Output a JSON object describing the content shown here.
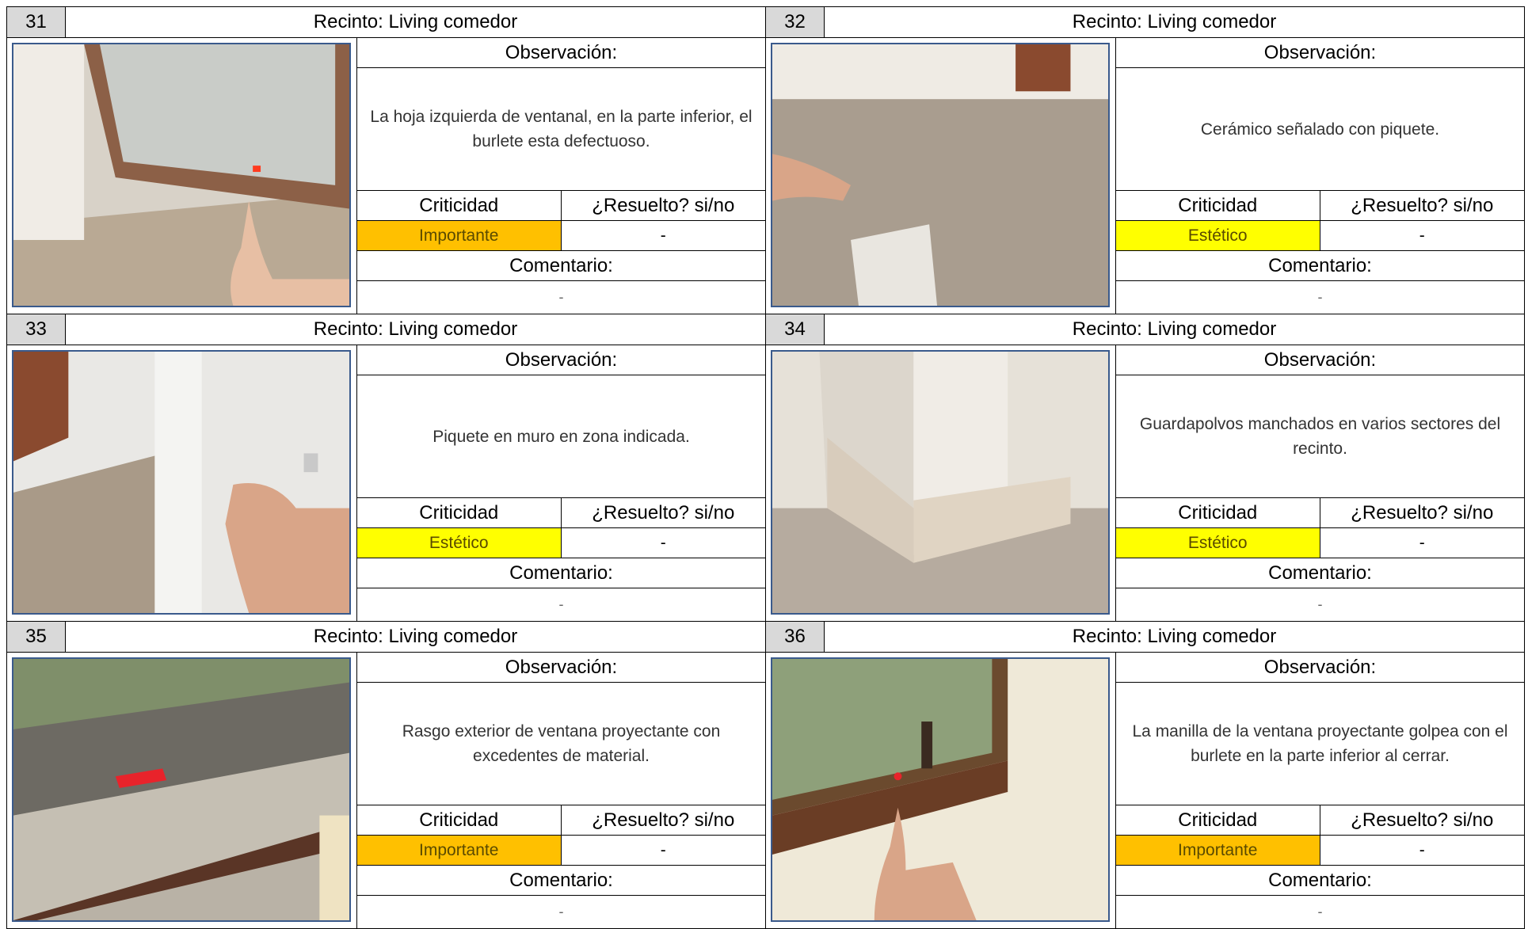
{
  "colors": {
    "importante": "#ffc000",
    "estetico": "#ffff00",
    "header_number_bg": "#d9d9d9",
    "photo_border": "#3a5a8c"
  },
  "labels": {
    "observacion": "Observación:",
    "criticidad": "Criticidad",
    "resuelto": "¿Resuelto? si/no",
    "comentario": "Comentario:"
  },
  "items": [
    {
      "number": "31",
      "recinto": "Recinto: Living comedor",
      "observacion": "La hoja izquierda de ventanal, en la parte inferior, el burlete esta defectuoso.",
      "criticidad": "Importante",
      "criticidad_color": "#ffc000",
      "resuelto": "-",
      "comentario": "-",
      "photo": "window-frame"
    },
    {
      "number": "32",
      "recinto": "Recinto: Living comedor",
      "observacion": "Cerámico señalado con piquete.",
      "criticidad": "Estético",
      "criticidad_color": "#ffff00",
      "resuelto": "-",
      "comentario": "-",
      "photo": "floor"
    },
    {
      "number": "33",
      "recinto": "Recinto: Living comedor",
      "observacion": "Piquete en muro en zona indicada.",
      "criticidad": "Estético",
      "criticidad_color": "#ffff00",
      "resuelto": "-",
      "comentario": "-",
      "photo": "wall"
    },
    {
      "number": "34",
      "recinto": "Recinto: Living comedor",
      "observacion": "Guardapolvos manchados en varios sectores del recinto.",
      "criticidad": "Estético",
      "criticidad_color": "#ffff00",
      "resuelto": "-",
      "comentario": "-",
      "photo": "baseboard"
    },
    {
      "number": "35",
      "recinto": "Recinto: Living comedor",
      "observacion": "Rasgo exterior de ventana proyectante con excedentes de material.",
      "criticidad": "Importante",
      "criticidad_color": "#ffc000",
      "resuelto": "-",
      "comentario": "-",
      "photo": "exterior-sill"
    },
    {
      "number": "36",
      "recinto": "Recinto: Living comedor",
      "observacion": "La manilla de la ventana proyectante golpea con el burlete en la parte inferior al cerrar.",
      "criticidad": "Importante",
      "criticidad_color": "#ffc000",
      "resuelto": "-",
      "comentario": "-",
      "photo": "window-handle"
    }
  ]
}
